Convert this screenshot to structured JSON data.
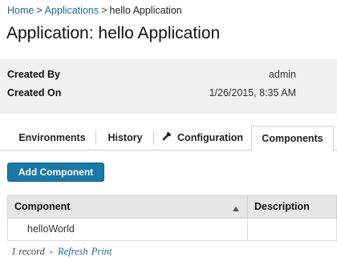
{
  "breadcrumb": {
    "home": "Home",
    "separator": ">",
    "applications": "Applications",
    "current": "hello Application"
  },
  "page": {
    "title": "Application: hello Application"
  },
  "info": {
    "created_by_label": "Created By",
    "created_by_value": "admin",
    "created_on_label": "Created On",
    "created_on_value": "1/26/2015, 8:35 AM"
  },
  "tabs": [
    {
      "label": "Environments"
    },
    {
      "label": "History"
    },
    {
      "label": "Configuration",
      "icon": "wrench-icon"
    },
    {
      "label": "Components",
      "active": true
    }
  ],
  "actions": {
    "add_component": "Add Component"
  },
  "table": {
    "columns": [
      "Component",
      "Description"
    ],
    "sort": {
      "column": "Component",
      "direction": "ascending",
      "icon": "sort-up-icon"
    },
    "rows": [
      {
        "component": "helloWorld",
        "description": ""
      }
    ]
  },
  "footer": {
    "count": "1 record",
    "dash": "-",
    "refresh": "Refresh",
    "print": "Print"
  },
  "colors": {
    "link": "#1f6aa5",
    "button": "#1b79a8",
    "panel": "#f0f0f0",
    "header": "#e6e6e6"
  }
}
